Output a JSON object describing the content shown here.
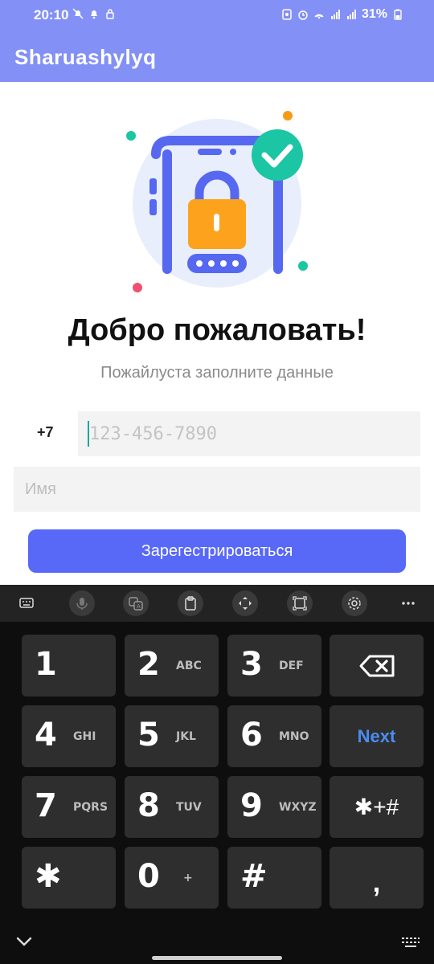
{
  "status_bar": {
    "time": "20:10",
    "battery": "31%",
    "icons_left": [
      "bell-off-icon",
      "bell-icon",
      "lock-icon"
    ],
    "icons_right": [
      "nfc-icon",
      "alarm-icon",
      "hotspot-icon",
      "signal-icon",
      "4g-signal-icon",
      "battery-icon"
    ]
  },
  "app_bar": {
    "title": "Sharuashylyq",
    "color": "#8390f6"
  },
  "main": {
    "illustration": "phone-lock-illustration",
    "welcome_title": "Добро пожаловать!",
    "subtitle": "Пожайлуста заполните данные",
    "country_code": "+7",
    "phone_placeholder": "123-456-7890",
    "name_placeholder": "Имя",
    "register_button": "Зарегестрироваться",
    "accent_color": "#5868f7"
  },
  "keyboard": {
    "toolbar": [
      "keyboard-icon",
      "mic-icon",
      "translate-icon",
      "clipboard-icon",
      "move-icon",
      "resize-icon",
      "settings-icon",
      "more-icon"
    ],
    "keys": [
      {
        "num": "1",
        "letters": ""
      },
      {
        "num": "2",
        "letters": "ABC"
      },
      {
        "num": "3",
        "letters": "DEF"
      },
      {
        "num": "4",
        "letters": "GHI"
      },
      {
        "num": "5",
        "letters": "JKL"
      },
      {
        "num": "6",
        "letters": "MNO"
      },
      {
        "num": "7",
        "letters": "PQRS"
      },
      {
        "num": "8",
        "letters": "TUV"
      },
      {
        "num": "9",
        "letters": "WXYZ"
      },
      {
        "num": "✱",
        "letters": ""
      },
      {
        "num": "0",
        "letters": "+"
      },
      {
        "num": "#",
        "letters": ""
      }
    ],
    "next_label": "Next",
    "symbols_label": "✱+#",
    "comma_label": ","
  }
}
